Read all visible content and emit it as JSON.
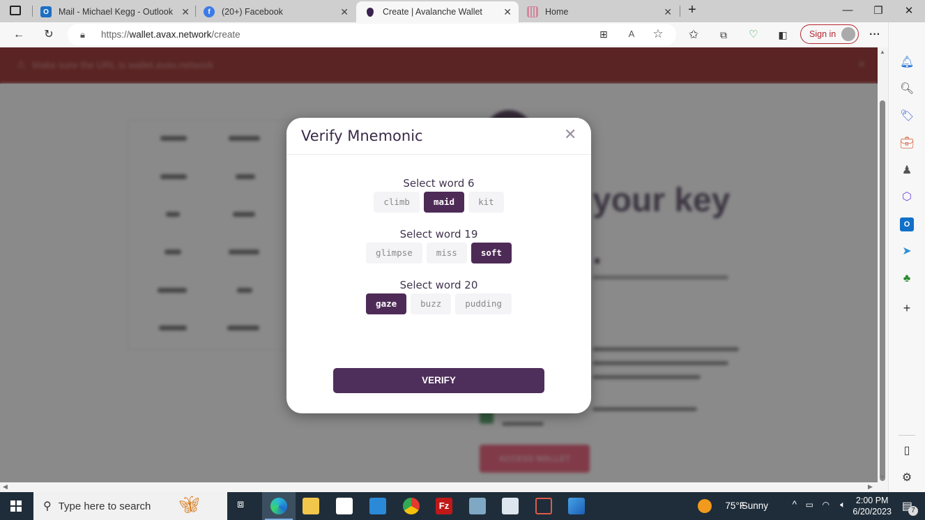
{
  "browser": {
    "tabs": [
      {
        "title": "Mail - Michael Kegg - Outlook",
        "icon": "outlook-icon",
        "active": false
      },
      {
        "title": "(20+) Facebook",
        "icon": "facebook-icon",
        "active": false
      },
      {
        "title": "Create | Avalanche Wallet",
        "icon": "avalanche-icon",
        "active": true
      },
      {
        "title": "Home",
        "icon": "home-grid-icon",
        "active": false
      }
    ],
    "new_tab_label": "+",
    "url_prefix": "https://",
    "url_domain": "wallet.avax.network",
    "url_path": "/create",
    "sign_in_label": "Sign in",
    "more_label": "···"
  },
  "page": {
    "banner_text": "Make sure the URL is wallet.avax.network",
    "background_heading_fragment": "your key",
    "background_button": "ACCESS WALLET"
  },
  "modal": {
    "title": "Verify Mnemonic",
    "close_label": "✕",
    "groups": [
      {
        "label": "Select word 6",
        "options": [
          "climb",
          "maid",
          "kit"
        ],
        "selected": "maid"
      },
      {
        "label": "Select word 19",
        "options": [
          "glimpse",
          "miss",
          "soft"
        ],
        "selected": "soft"
      },
      {
        "label": "Select word 20",
        "options": [
          "gaze",
          "buzz",
          "pudding"
        ],
        "selected": "gaze"
      }
    ],
    "verify_label": "VERIFY"
  },
  "colors": {
    "accent": "#4e2b57",
    "banner": "#8a0000",
    "signin": "#b3262f"
  },
  "taskbar": {
    "search_placeholder": "Type here to search",
    "weather_temp": "75°F",
    "weather_text": "Sunny",
    "time": "2:00 PM",
    "date": "6/20/2023",
    "notification_count": "7"
  }
}
